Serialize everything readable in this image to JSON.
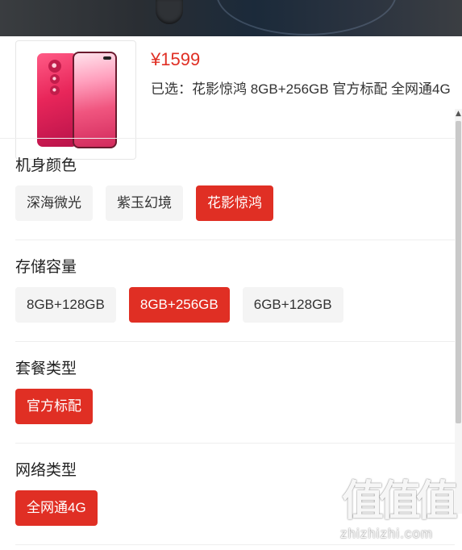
{
  "product": {
    "price": "¥1599",
    "selected_text": "已选：花影惊鸿 8GB+256GB 官方标配 全网通4G"
  },
  "sections": [
    {
      "title": "机身颜色",
      "options": [
        {
          "label": "深海微光",
          "selected": false
        },
        {
          "label": "紫玉幻境",
          "selected": false
        },
        {
          "label": "花影惊鸿",
          "selected": true
        }
      ]
    },
    {
      "title": "存储容量",
      "options": [
        {
          "label": "8GB+128GB",
          "selected": false
        },
        {
          "label": "8GB+256GB",
          "selected": true
        },
        {
          "label": "6GB+128GB",
          "selected": false
        }
      ]
    },
    {
      "title": "套餐类型",
      "options": [
        {
          "label": "官方标配",
          "selected": true
        }
      ]
    },
    {
      "title": "网络类型",
      "options": [
        {
          "label": "全网通4G",
          "selected": true
        }
      ]
    }
  ],
  "watermark": {
    "chars": [
      "值",
      "值",
      "值"
    ],
    "url": "zhizhizhi.com"
  },
  "colors": {
    "accent": "#e02f24",
    "option_bg": "#f4f4f4",
    "text": "#222222"
  }
}
